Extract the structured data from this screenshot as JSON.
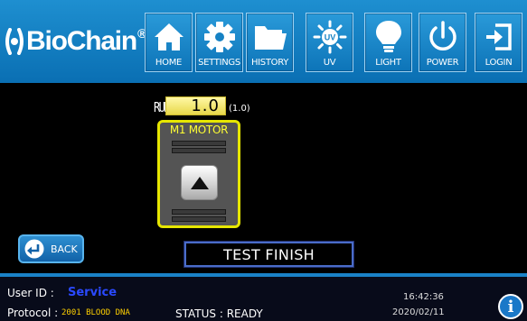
{
  "brand": {
    "name": "BioChain",
    "registered": "®"
  },
  "nav": [
    {
      "label": "HOME",
      "icon": "home-icon"
    },
    {
      "label": "SETTINGS",
      "icon": "gear-icon"
    },
    {
      "label": "HISTORY",
      "icon": "folder-icon"
    },
    {
      "label": "UV",
      "icon": "uv-lamp-icon"
    },
    {
      "label": "LIGHT",
      "icon": "lightbulb-icon"
    },
    {
      "label": "POWER",
      "icon": "power-icon"
    },
    {
      "label": "LOGIN",
      "icon": "login-icon"
    }
  ],
  "run": {
    "label": "RUN",
    "value": "1.0",
    "default": "(1.0)"
  },
  "motor": {
    "title": "M1 MOTOR",
    "button_icon": "triangle-up-icon"
  },
  "back_button": {
    "label": "BACK",
    "icon": "return-arrow-icon"
  },
  "status_message": "TEST FINISH",
  "footer": {
    "user_id_label": "User ID :",
    "user_id": "Service",
    "protocol_label": "Protocol :",
    "protocol": "2001 BLOOD DNA",
    "status_label": "STATUS : READY",
    "time": "16:42:36",
    "date": "2020/02/11",
    "info_icon": "info-icon"
  },
  "colors": {
    "topbar": "#0a6fb3",
    "motor_border": "#e6e600",
    "user_id": "#2a49ff",
    "protocol": "#ffd000",
    "status_box_border": "#4a6cc9"
  }
}
